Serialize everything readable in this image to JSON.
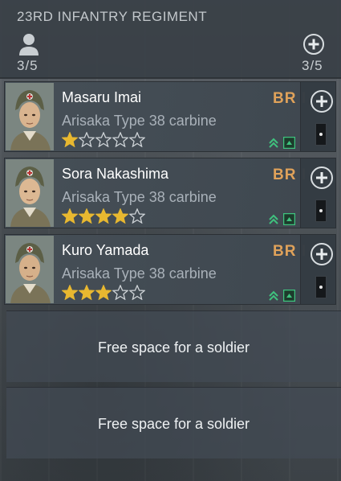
{
  "header": {
    "title": "23RD INFANTRY REGIMENT",
    "left_count": "3/5",
    "right_count": "3/5",
    "person_icon": "person-icon",
    "add_icon": "plus-circle-icon"
  },
  "soldiers": [
    {
      "name": "Masaru Imai",
      "weapon": "Arisaka Type 38 carbine",
      "br": "BR I",
      "stars_filled": 1,
      "stars_total": 5
    },
    {
      "name": "Sora Nakashima",
      "weapon": "Arisaka Type 38 carbine",
      "br": "BR I",
      "stars_filled": 4,
      "stars_total": 5
    },
    {
      "name": "Kuro Yamada",
      "weapon": "Arisaka Type 38 carbine",
      "br": "BR I",
      "stars_filled": 3,
      "stars_total": 5
    }
  ],
  "free_slots": [
    {
      "label": "Free space for a soldier"
    },
    {
      "label": "Free space for a soldier"
    }
  ],
  "colors": {
    "br": "#e0a25a",
    "star": "#e8b830",
    "upgrade": "#3fc27e"
  }
}
